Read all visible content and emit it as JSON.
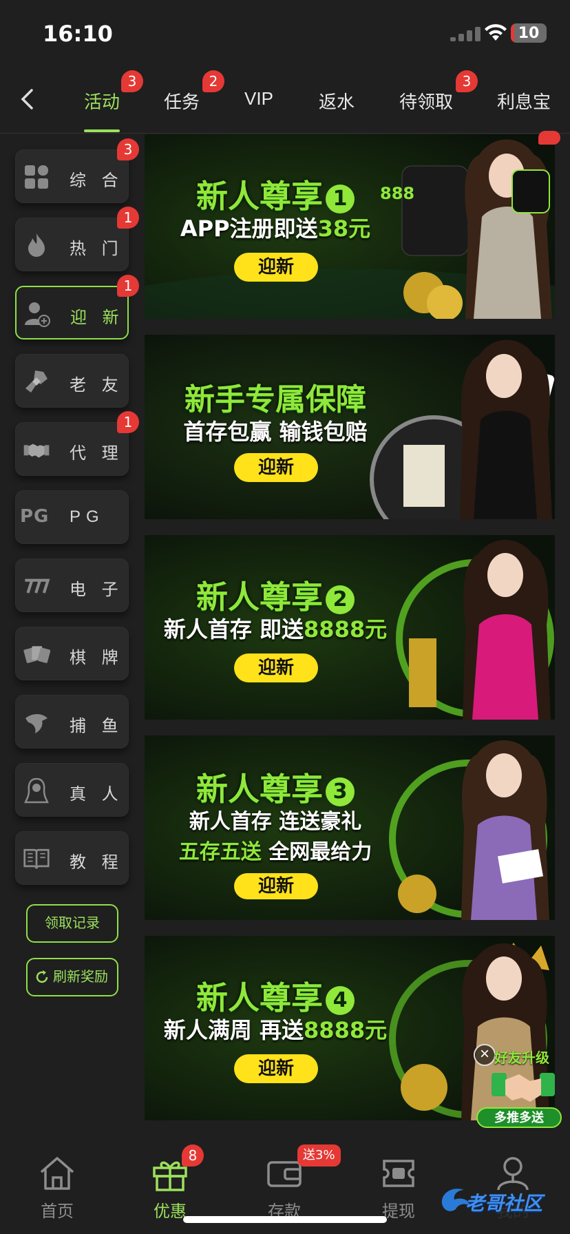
{
  "status_bar": {
    "time": "16:10",
    "battery": "10",
    "battery_level": 0.1
  },
  "top_tabs": [
    {
      "label": "活动",
      "badge": "3",
      "active": true
    },
    {
      "label": "任务",
      "badge": "2"
    },
    {
      "label": "VIP"
    },
    {
      "label": "返水"
    },
    {
      "label": "待领取",
      "badge": "3"
    },
    {
      "label": "利息宝"
    }
  ],
  "sidebar": {
    "items": [
      {
        "label": "综 合",
        "icon": "grid-icon",
        "badge": "3"
      },
      {
        "label": "热 门",
        "icon": "flame-icon",
        "badge": "1"
      },
      {
        "label": "迎 新",
        "icon": "user-add-icon",
        "badge": "1",
        "active": true
      },
      {
        "label": "老 友",
        "icon": "fist-bump-icon"
      },
      {
        "label": "代 理",
        "icon": "handshake-icon",
        "badge": "1"
      },
      {
        "label": "PG",
        "icon": "pg-logo-icon",
        "icon_text": "PG"
      },
      {
        "label": "电 子",
        "icon": "slot-777-icon"
      },
      {
        "label": "棋 牌",
        "icon": "playing-cards-icon"
      },
      {
        "label": "捕 鱼",
        "icon": "shark-icon"
      },
      {
        "label": "真 人",
        "icon": "dealer-woman-icon"
      },
      {
        "label": "教 程",
        "icon": "book-icon"
      }
    ],
    "claim_record": "领取记录",
    "refresh_reward": "刷新奖励"
  },
  "banners": [
    {
      "title": "新人尊享",
      "title_num": "1",
      "line1_white": "APP注册即送",
      "line1_green": "38元",
      "button": "迎新",
      "logo": "888"
    },
    {
      "title": "新手专属保障",
      "line1_white": "首存包赢 输钱包赔",
      "button": "迎新"
    },
    {
      "title": "新人尊享",
      "title_num": "2",
      "line1_white": "新人首存 即送",
      "line1_green": "8888元",
      "button": "迎新"
    },
    {
      "title": "新人尊享",
      "title_num": "3",
      "line1_white": "新人首存 连送豪礼",
      "line2_green": "五存五送",
      "line2_white": " 全网最给力",
      "button": "迎新"
    },
    {
      "title": "新人尊享",
      "title_num": "4",
      "line1_white": "新人满周 再送",
      "line1_green": "8888元",
      "button": "迎新"
    }
  ],
  "floating_promo": {
    "top_text": "好友升级",
    "bottom_text": "多推多送"
  },
  "bottom_tabs": [
    {
      "label": "首页",
      "icon": "home-icon"
    },
    {
      "label": "优惠",
      "icon": "gift-icon",
      "badge": "8",
      "active": true
    },
    {
      "label": "存款",
      "icon": "wallet-icon",
      "badge": "送3%"
    },
    {
      "label": "提现",
      "icon": "withdraw-icon"
    },
    {
      "label": "我的",
      "icon": "profile-icon"
    }
  ],
  "watermark": "老哥社区",
  "colors": {
    "accent": "#9be15d",
    "badge": "#e53935",
    "background": "#1f1f1f",
    "button_yellow": "#ffe21a"
  }
}
